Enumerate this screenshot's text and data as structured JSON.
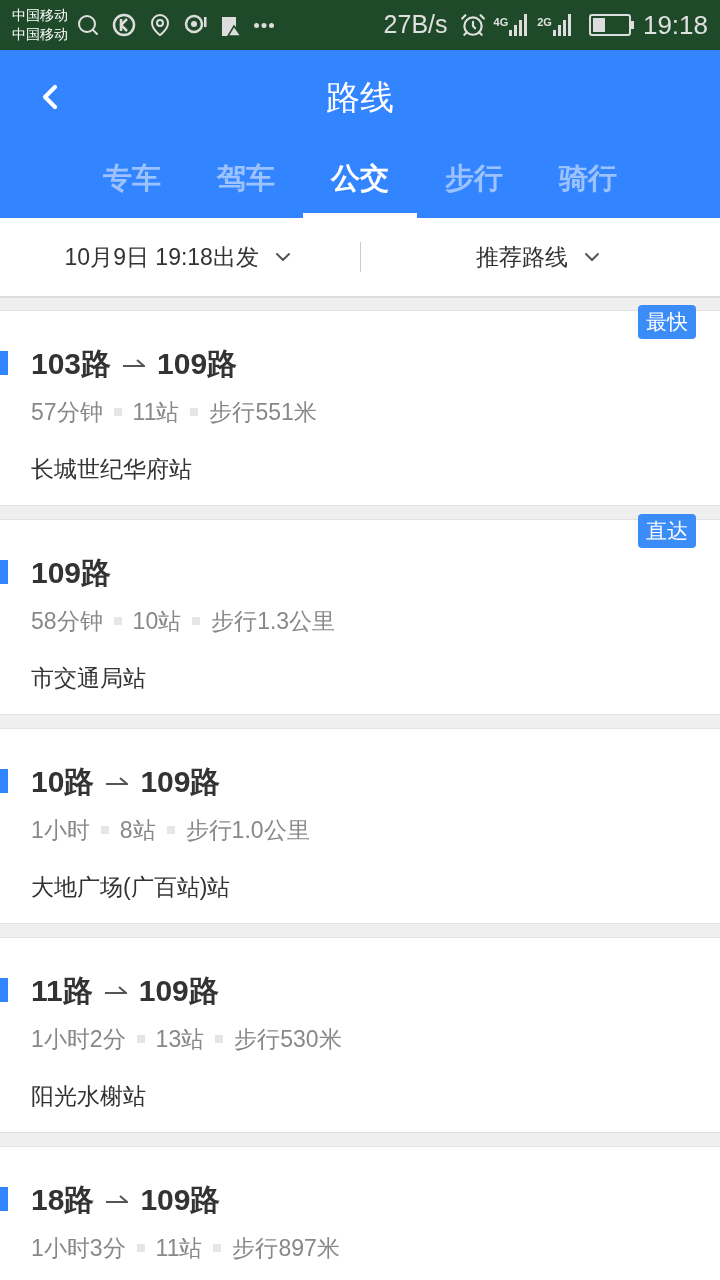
{
  "status_bar": {
    "carriers": [
      "中国移动",
      "中国移动"
    ],
    "speed": "27B/s",
    "networks": [
      "4G",
      "2G"
    ],
    "time": "19:18"
  },
  "header": {
    "title": "路线"
  },
  "tabs": [
    {
      "label": "专车",
      "selected": false
    },
    {
      "label": "驾车",
      "selected": false
    },
    {
      "label": "公交",
      "selected": true
    },
    {
      "label": "步行",
      "selected": false
    },
    {
      "label": "骑行",
      "selected": false
    }
  ],
  "filters": [
    {
      "label": "10月9日 19:18出发"
    },
    {
      "label": "推荐路线"
    }
  ],
  "routes": [
    {
      "lines": [
        "103路",
        "109路"
      ],
      "badge": "最快",
      "info": [
        "57分钟",
        "11站",
        "步行551米"
      ],
      "station": "长城世纪华府站"
    },
    {
      "lines": [
        "109路"
      ],
      "badge": "直达",
      "info": [
        "58分钟",
        "10站",
        "步行1.3公里"
      ],
      "station": "市交通局站"
    },
    {
      "lines": [
        "10路",
        "109路"
      ],
      "info": [
        "1小时",
        "8站",
        "步行1.0公里"
      ],
      "station": "大地广场(广百站)站"
    },
    {
      "lines": [
        "11路",
        "109路"
      ],
      "info": [
        "1小时2分",
        "13站",
        "步行530米"
      ],
      "station": "阳光水榭站"
    },
    {
      "lines": [
        "18路",
        "109路"
      ],
      "info": [
        "1小时3分",
        "11站",
        "步行897米"
      ]
    }
  ]
}
